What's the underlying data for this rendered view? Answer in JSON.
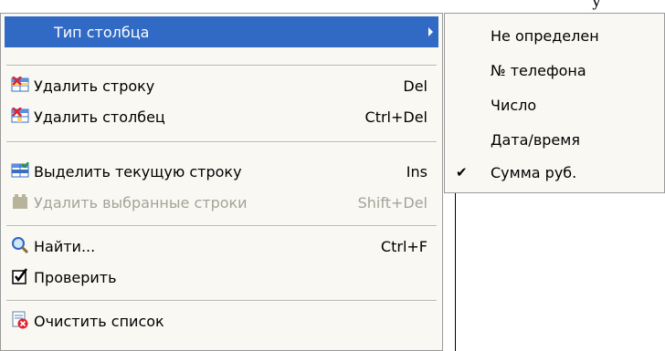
{
  "background_text": "у",
  "menu": {
    "items": [
      {
        "label": "Тип столбца",
        "shortcut": "",
        "icon": "none",
        "has_submenu": true,
        "highlighted": true,
        "enabled": true
      },
      {
        "label": "Удалить строку",
        "shortcut": "Del",
        "icon": "delete-row-icon",
        "enabled": true
      },
      {
        "label": "Удалить столбец",
        "shortcut": "Ctrl+Del",
        "icon": "delete-column-icon",
        "enabled": true
      },
      {
        "label": "Выделить текущую строку",
        "shortcut": "Ins",
        "icon": "select-row-icon",
        "enabled": true
      },
      {
        "label": "Удалить выбранные строки",
        "shortcut": "Shift+Del",
        "icon": "delete-selected-rows-icon",
        "enabled": false
      },
      {
        "label": "Найти...",
        "shortcut": "Ctrl+F",
        "icon": "magnifier-icon",
        "enabled": true
      },
      {
        "label": "Проверить",
        "shortcut": "",
        "icon": "checkbox-icon",
        "enabled": true
      },
      {
        "label": "Очистить список",
        "shortcut": "",
        "icon": "clear-list-icon",
        "enabled": true
      }
    ]
  },
  "submenu": {
    "items": [
      {
        "label": "Не определен",
        "checked": false
      },
      {
        "label": "№ телефона",
        "checked": false
      },
      {
        "label": "Число",
        "checked": false
      },
      {
        "label": "Дата/время",
        "checked": false
      },
      {
        "label": "Сумма руб.",
        "checked": true
      }
    ],
    "check_glyph": "✔"
  },
  "colors": {
    "highlight": "#316ac5",
    "menu_bg": "#f9f8f3",
    "disabled_text": "#a5a396"
  }
}
